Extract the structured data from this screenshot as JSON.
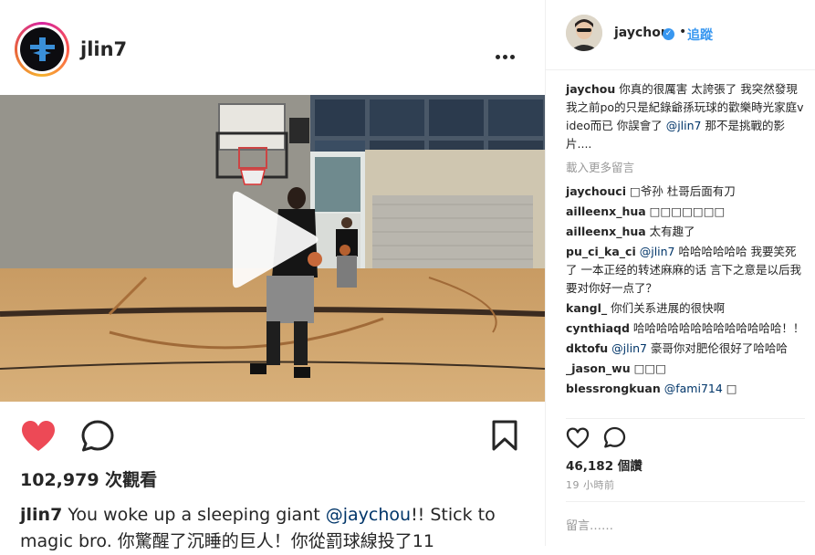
{
  "post": {
    "author": "jlin7",
    "more_label": "•••",
    "views": "102,979 次觀看",
    "caption_user": "jlin7",
    "caption_pre": " You woke up a sleeping giant ",
    "caption_mention": "@jaychou",
    "caption_post": "!! Stick to magic bro. 你驚醒了沉睡的巨人！你從罰球線投了11"
  },
  "sidebar": {
    "author": "jaychou",
    "verified_mark": "✓",
    "dot": "•",
    "follow_label": "追蹤",
    "load_more": "載入更多留言",
    "comments": [
      {
        "user": "jaychou",
        "text": " 你真的很厲害 太誇張了 我突然發現我之前po的只是紀錄爺孫玩球的歡樂時光家庭video而已 你誤會了 ",
        "mention": "@jlin7",
        "tail": " 那不是挑戰的影片...."
      },
      {
        "user": "jaychouci",
        "text": " □爷孙 杜哥后面有刀",
        "mention": "",
        "tail": ""
      },
      {
        "user": "ailleenx_hua",
        "text": " □□□□□□□",
        "mention": "",
        "tail": ""
      },
      {
        "user": "ailleenx_hua",
        "text": " 太有趣了",
        "mention": "",
        "tail": ""
      },
      {
        "user": "pu_ci_ka_ci",
        "text": " ",
        "mention": "@jlin7",
        "tail": " 哈哈哈哈哈哈 我要笑死了 一本正经的转述麻麻的话 言下之意是以后我要对你好一点了？"
      },
      {
        "user": "kangl_",
        "text": " 你们关系进展的很快啊",
        "mention": "",
        "tail": ""
      },
      {
        "user": "cynthiaqd",
        "text": " 哈哈哈哈哈哈哈哈哈哈哈哈哈！！",
        "mention": "",
        "tail": ""
      },
      {
        "user": "dktofu",
        "text": " ",
        "mention": "@jlin7",
        "tail": " 豪哥你对肥伦很好了哈哈哈"
      },
      {
        "user": "_jason_wu",
        "text": " □□□",
        "mention": "",
        "tail": ""
      },
      {
        "user": "blessrongkuan",
        "text": " ",
        "mention": "@fami714",
        "tail": " □"
      }
    ],
    "likes": "46,182 個讚",
    "time": "19 小時前",
    "add_comment_placeholder": "留言……"
  },
  "colors": {
    "accent": "#3897f0",
    "heart": "#ed4956",
    "muted": "#999999",
    "mention": "#003569"
  },
  "icons": [
    "heart-icon",
    "comment-icon",
    "bookmark-icon",
    "more-icon",
    "play-icon",
    "verified-icon"
  ]
}
